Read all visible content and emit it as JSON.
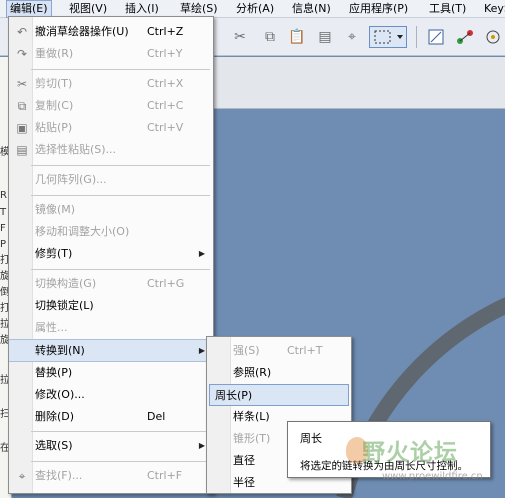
{
  "menubar": {
    "items": [
      {
        "label": "编辑(E)",
        "active": true
      },
      {
        "label": "视图(V)"
      },
      {
        "label": "插入(I)"
      },
      {
        "label": "草绘(S)"
      },
      {
        "label": "分析(A)"
      },
      {
        "label": "信息(N)"
      },
      {
        "label": "应用程序(P)"
      },
      {
        "label": "工具(T)"
      },
      {
        "label": "KeyS"
      }
    ]
  },
  "toolbar": {
    "icons": [
      "cut-icon",
      "copy-icon",
      "paste-icon",
      "paste-special-icon",
      "find-icon",
      "select-box-icon",
      "dropdown-arrow-icon",
      "sketch-setup-icon",
      "constraints-icon",
      "dimension-icon"
    ]
  },
  "left_panel": {
    "chars": [
      "模",
      "R",
      "T",
      "F",
      "P",
      "打",
      "旋",
      "倒",
      "打",
      "拉",
      "旋",
      "拉",
      "扫",
      "在"
    ]
  },
  "edit_menu": {
    "items": [
      {
        "label": "撤消草绘器操作(U)",
        "shortcut": "Ctrl+Z",
        "icon": "undo-icon",
        "disabled": false
      },
      {
        "label": "重做(R)",
        "shortcut": "Ctrl+Y",
        "icon": "redo-icon",
        "disabled": true
      },
      {
        "label": "剪切(T)",
        "shortcut": "Ctrl+X",
        "icon": "cut-icon",
        "disabled": true
      },
      {
        "label": "复制(C)",
        "shortcut": "Ctrl+C",
        "icon": "copy-icon",
        "disabled": true
      },
      {
        "label": "粘贴(P)",
        "shortcut": "Ctrl+V",
        "icon": "paste-icon",
        "disabled": true
      },
      {
        "label": "选择性粘贴(S)...",
        "shortcut": "",
        "icon": "paste-special-icon",
        "disabled": true
      },
      {
        "label": "几何阵列(G)...",
        "shortcut": "",
        "icon": "",
        "disabled": true
      },
      {
        "label": "镜像(M)",
        "shortcut": "",
        "icon": "",
        "disabled": true
      },
      {
        "label": "移动和调整大小(O)",
        "shortcut": "",
        "icon": "",
        "disabled": true
      },
      {
        "label": "修剪(T)",
        "shortcut": "",
        "icon": "",
        "disabled": false,
        "submenu": true
      },
      {
        "label": "切换构造(G)",
        "shortcut": "Ctrl+G",
        "icon": "",
        "disabled": true
      },
      {
        "label": "切换锁定(L)",
        "shortcut": "",
        "icon": "",
        "disabled": false
      },
      {
        "label": "属性...",
        "shortcut": "",
        "icon": "",
        "disabled": true
      },
      {
        "label": "转换到(N)",
        "shortcut": "",
        "icon": "",
        "disabled": false,
        "submenu": true,
        "highlighted": true
      },
      {
        "label": "替换(P)",
        "shortcut": "",
        "icon": "",
        "disabled": false
      },
      {
        "label": "修改(O)...",
        "shortcut": "",
        "icon": "",
        "disabled": false
      },
      {
        "label": "删除(D)",
        "shortcut": "Del",
        "icon": "",
        "disabled": false
      },
      {
        "label": "选取(S)",
        "shortcut": "",
        "icon": "",
        "disabled": false,
        "submenu": true
      },
      {
        "label": "查找(F)...",
        "shortcut": "Ctrl+F",
        "icon": "find-icon",
        "disabled": true
      }
    ]
  },
  "convert_submenu": {
    "items": [
      {
        "label": "强(S)",
        "shortcut": "Ctrl+T",
        "disabled": true
      },
      {
        "label": "参照(R)",
        "shortcut": "",
        "disabled": false
      },
      {
        "label": "周长(P)",
        "shortcut": "",
        "disabled": false,
        "highlighted": true
      },
      {
        "label": "样条(L)",
        "shortcut": "",
        "disabled": false
      },
      {
        "label": "锥形(T)",
        "shortcut": "",
        "disabled": true
      },
      {
        "label": "直径",
        "shortcut": "",
        "disabled": false
      },
      {
        "label": "半径",
        "shortcut": "",
        "disabled": false
      }
    ]
  },
  "tooltip": {
    "title": "周长",
    "text": "将选定的链转换为由周长尺寸控制。"
  },
  "watermark": {
    "text": "野火论坛",
    "url": "www.proewildfire.cn"
  },
  "colors": {
    "canvas": "#6f8db3",
    "arc": "#5f6771",
    "highlight": "#dbe6f5"
  }
}
